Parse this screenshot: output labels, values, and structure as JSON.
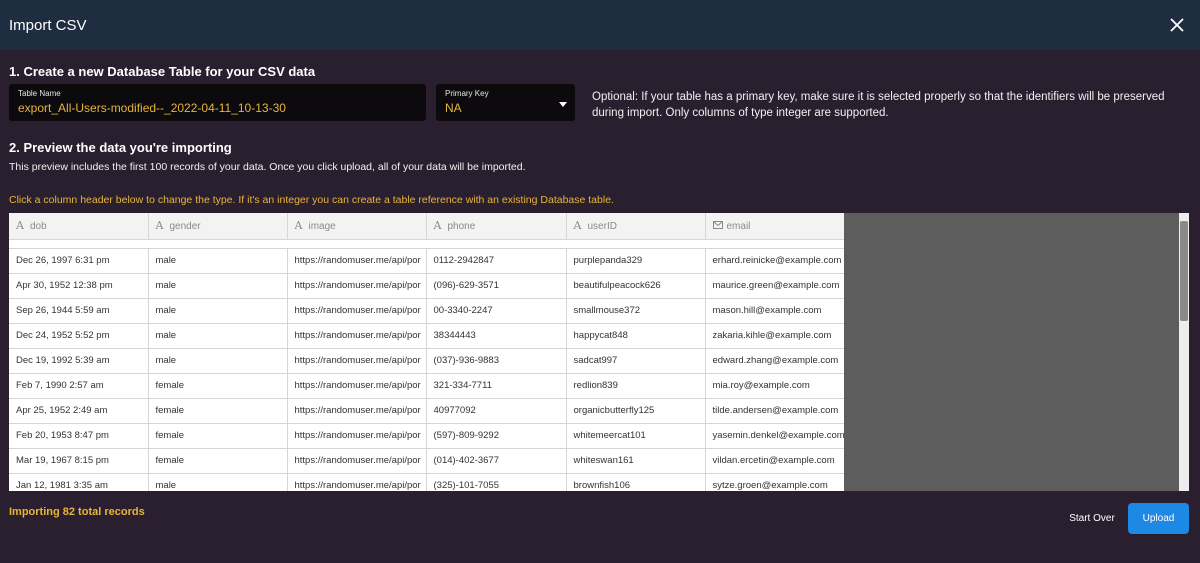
{
  "header": {
    "title": "Import CSV"
  },
  "section1": {
    "title": "1. Create a new Database Table for your CSV data",
    "table_name_label": "Table Name",
    "table_name_value": "export_All-Users-modified--_2022-04-11_10-13-30",
    "primary_key_label": "Primary Key",
    "primary_key_value": "NA",
    "note": "Optional: If your table has a primary key, make sure it is selected properly so that the identifiers will be preserved during import. Only columns of type integer are supported."
  },
  "section2": {
    "title": "2. Preview the data you're importing",
    "description": "This preview includes the first 100 records of your data. Once you click upload, all of your data will be imported.",
    "hint": "Click a column header below to change the type. If it's an integer you can create a table reference with an existing Database table."
  },
  "table": {
    "columns": [
      {
        "label": "dob",
        "icon": "text-type-icon"
      },
      {
        "label": "gender",
        "icon": "text-type-icon"
      },
      {
        "label": "image",
        "icon": "text-type-icon"
      },
      {
        "label": "phone",
        "icon": "text-type-icon"
      },
      {
        "label": "userID",
        "icon": "text-type-icon"
      },
      {
        "label": "email",
        "icon": "email-type-icon"
      }
    ],
    "rows": [
      [
        "Dec 26, 1997 6:31 pm",
        "male",
        "https://randomuser.me/api/por",
        "0112-2942847",
        "purplepanda329",
        "erhard.reinicke@example.com"
      ],
      [
        "Apr 30, 1952 12:38 pm",
        "male",
        "https://randomuser.me/api/por",
        "(096)-629-3571",
        "beautifulpeacock626",
        "maurice.green@example.com"
      ],
      [
        "Sep 26, 1944 5:59 am",
        "male",
        "https://randomuser.me/api/por",
        "00-3340-2247",
        "smallmouse372",
        "mason.hill@example.com"
      ],
      [
        "Dec 24, 1952 5:52 pm",
        "male",
        "https://randomuser.me/api/por",
        "38344443",
        "happycat848",
        "zakaria.kihle@example.com"
      ],
      [
        "Dec 19, 1992 5:39 am",
        "male",
        "https://randomuser.me/api/por",
        "(037)-936-9883",
        "sadcat997",
        "edward.zhang@example.com"
      ],
      [
        "Feb 7, 1990 2:57 am",
        "female",
        "https://randomuser.me/api/por",
        "321-334-7711",
        "redlion839",
        "mia.roy@example.com"
      ],
      [
        "Apr 25, 1952 2:49 am",
        "female",
        "https://randomuser.me/api/por",
        "40977092",
        "organicbutterfly125",
        "tilde.andersen@example.com"
      ],
      [
        "Feb 20, 1953 8:47 pm",
        "female",
        "https://randomuser.me/api/por",
        "(597)-809-9292",
        "whitemeercat101",
        "yasemin.denkel@example.com"
      ],
      [
        "Mar 19, 1967 8:15 pm",
        "female",
        "https://randomuser.me/api/por",
        "(014)-402-3677",
        "whiteswan161",
        "vildan.ercetin@example.com"
      ],
      [
        "Jan 12, 1981 3:35 am",
        "male",
        "https://randomuser.me/api/por",
        "(325)-101-7055",
        "brownfish106",
        "sytze.groen@example.com"
      ]
    ]
  },
  "footer": {
    "status": "Importing 82 total records",
    "start_over_label": "Start Over",
    "upload_label": "Upload"
  },
  "colors": {
    "header_bg": "#1e2d40",
    "body_bg": "#2a1f2e",
    "accent": "#e8b53a",
    "upload": "#1e88e5"
  }
}
